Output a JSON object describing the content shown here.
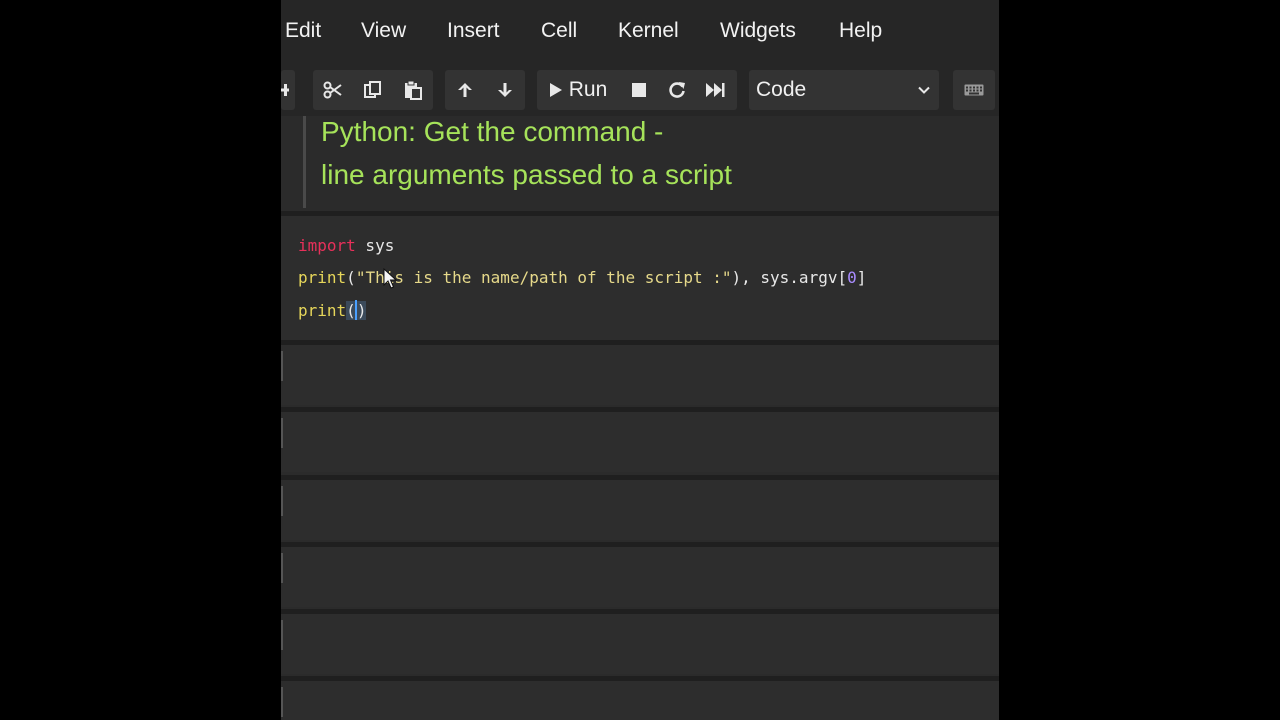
{
  "menubar": {
    "items": [
      "Edit",
      "View",
      "Insert",
      "Cell",
      "Kernel",
      "Widgets",
      "Help"
    ]
  },
  "toolbar": {
    "icons": [
      "plus-icon",
      "scissors-icon",
      "copy-icon",
      "paste-icon",
      "arrow-up-icon",
      "arrow-down-icon",
      "play-icon",
      "stop-icon",
      "restart-icon",
      "fast-forward-icon",
      "chevron-down-icon",
      "keyboard-icon"
    ],
    "run_label": "Run",
    "cell_type": "Code"
  },
  "markdown_cell": {
    "line1": "Python: Get the command -",
    "line2": "line arguments passed to a script"
  },
  "code_cell": {
    "line1": {
      "keyword": "import",
      "rest": " sys"
    },
    "line2": {
      "func": "print",
      "open": "(",
      "string": "\"This is the name/path of the script :\"",
      "mid": "), sys.argv[",
      "number": "0",
      "close": "]"
    },
    "line3": {
      "func": "print",
      "open": "(",
      "close": ")"
    }
  },
  "colors": {
    "markdown_heading": "#a6e35a",
    "keyword": "#e8305a",
    "function": "#e6d65a",
    "string": "#e6d98a",
    "number": "#a98cff",
    "cursor": "#4aa0ff",
    "background": "#2b2b2b"
  }
}
